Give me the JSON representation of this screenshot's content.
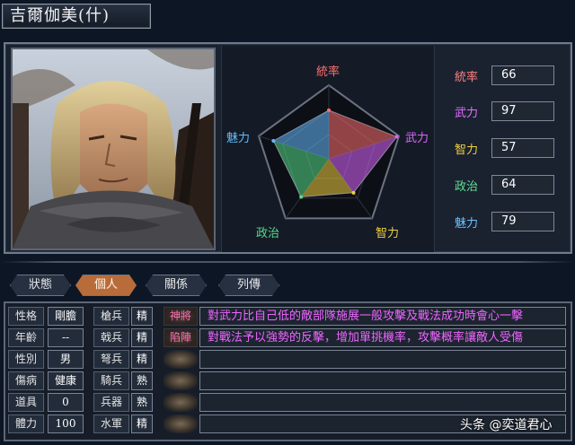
{
  "character": {
    "name": "吉爾伽美(什)"
  },
  "radar": {
    "axes": [
      {
        "label": "統率",
        "value": 66,
        "color": "#ff7070"
      },
      {
        "label": "武力",
        "value": 97,
        "color": "#dd66ff"
      },
      {
        "label": "智力",
        "value": 57,
        "color": "#f0d040"
      },
      {
        "label": "政治",
        "value": 64,
        "color": "#55dd88"
      },
      {
        "label": "魅力",
        "value": 79,
        "color": "#66bbff"
      }
    ]
  },
  "stats": [
    {
      "label": "統率",
      "value": "66",
      "color": "#ff8080"
    },
    {
      "label": "武力",
      "value": "97",
      "color": "#e070ff"
    },
    {
      "label": "智力",
      "value": "57",
      "color": "#f0d040"
    },
    {
      "label": "政治",
      "value": "64",
      "color": "#60e090"
    },
    {
      "label": "魅力",
      "value": "79",
      "color": "#70c0ff"
    }
  ],
  "tabs": [
    {
      "label": "狀態"
    },
    {
      "label": "個人"
    },
    {
      "label": "關係"
    },
    {
      "label": "列傳"
    }
  ],
  "personal": [
    {
      "label": "性格",
      "value": "剛膽"
    },
    {
      "label": "年齡",
      "value": "--"
    },
    {
      "label": "性別",
      "value": "男"
    },
    {
      "label": "傷病",
      "value": "健康"
    },
    {
      "label": "道具",
      "value": "0"
    },
    {
      "label": "體力",
      "value": "100"
    }
  ],
  "aptitude": [
    {
      "label": "槍兵",
      "value": "精"
    },
    {
      "label": "戟兵",
      "value": "精"
    },
    {
      "label": "弩兵",
      "value": "精"
    },
    {
      "label": "騎兵",
      "value": "熟"
    },
    {
      "label": "兵器",
      "value": "熟"
    },
    {
      "label": "水軍",
      "value": "精"
    }
  ],
  "skills": [
    {
      "name": "神將",
      "desc": "對武力比自己低的敵部隊施展一般攻擊及戰法成功時會心一擊"
    },
    {
      "name": "陷陣",
      "desc": "對戰法予以強勢的反擊，增加單挑機率，攻擊概率讓敵人受傷"
    },
    {
      "name": "",
      "desc": ""
    },
    {
      "name": "",
      "desc": ""
    },
    {
      "name": "",
      "desc": ""
    },
    {
      "name": "",
      "desc": ""
    }
  ],
  "watermark": "头条 @奕道君心"
}
